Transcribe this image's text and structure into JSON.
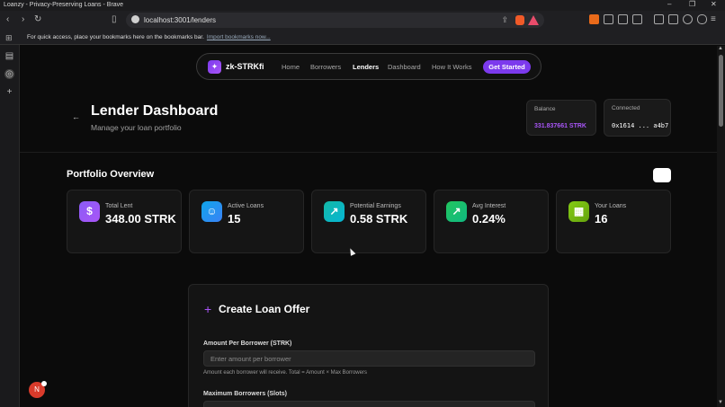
{
  "window": {
    "title": "Loanzy - Privacy-Preserving Loans - Brave"
  },
  "browser": {
    "url": "localhost:3001/lenders",
    "bookmarks_text": "For quick access, place your bookmarks here on the bookmarks bar.",
    "bookmarks_link": "Import bookmarks now..."
  },
  "nav": {
    "brand": "zk-STRKfi",
    "links": [
      "Home",
      "Borrowers",
      "Lenders",
      "Dashboard",
      "How It Works"
    ],
    "active": "Lenders",
    "cta": "Get Started"
  },
  "header": {
    "title": "Lender Dashboard",
    "subtitle": "Manage your loan portfolio",
    "balance_label": "Balance",
    "balance_value": "331.837661 STRK",
    "connected_label": "Connected",
    "connected_value": "0x1614 ... a4b7"
  },
  "portfolio": {
    "title": "Portfolio Overview",
    "cards": [
      {
        "label": "Total Lent",
        "value": "348.00 STRK",
        "icon": "dollar-icon",
        "color": "#8b5cf6"
      },
      {
        "label": "Active Loans",
        "value": "15",
        "icon": "users-icon",
        "color": "#0ea5e9"
      },
      {
        "label": "Potential Earnings",
        "value": "0.58 STRK",
        "icon": "trending-up-icon",
        "color": "#14b8a6"
      },
      {
        "label": "Avg Interest",
        "value": "0.24%",
        "icon": "trending-up-icon",
        "color": "#22c55e"
      },
      {
        "label": "Your Loans",
        "value": "16",
        "icon": "calendar-icon",
        "color": "#84cc16"
      }
    ]
  },
  "offer": {
    "title": "Create Loan Offer",
    "amount_label": "Amount Per Borrower (STRK)",
    "amount_placeholder": "Enter amount per borrower",
    "amount_hint": "Amount each borrower will receive. Total = Amount × Max Borrowers",
    "slots_label": "Maximum Borrowers (Slots)"
  },
  "colors": {
    "accent": "#7c3aed",
    "balance": "#a855f7",
    "background": "#0b0b0b"
  }
}
